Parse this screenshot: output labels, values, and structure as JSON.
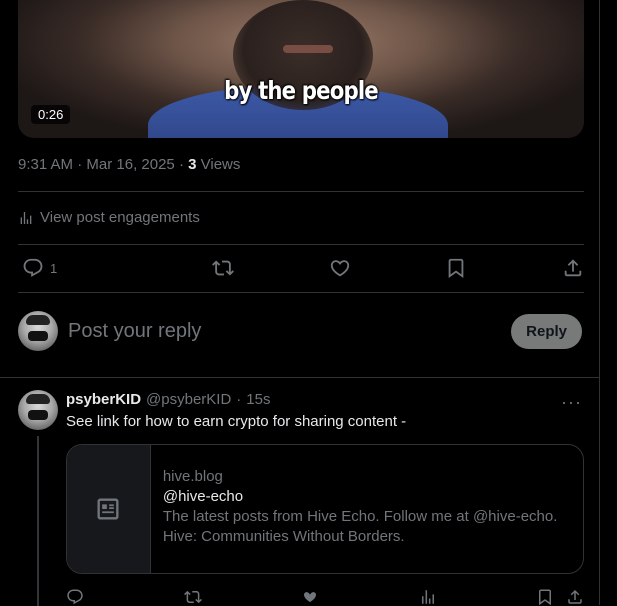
{
  "video": {
    "caption": "by the people",
    "duration": "0:26"
  },
  "post_meta": {
    "time": "9:31 AM",
    "sep1": " · ",
    "date": "Mar 16, 2025",
    "sep2": " · ",
    "views_count": "3",
    "views_label": " Views"
  },
  "engagements": {
    "label": "View post engagements",
    "icon": "analytics-icon"
  },
  "actions": {
    "reply_count": "1",
    "icons": [
      "reply-icon",
      "repost-icon",
      "like-icon",
      "bookmark-icon",
      "share-icon"
    ]
  },
  "reply_composer": {
    "placeholder": "Post your reply",
    "button": "Reply"
  },
  "reply_tweet": {
    "name": "psyberKID",
    "handle": "@psyberKID",
    "sep": "·",
    "time": "15s",
    "more": "···",
    "text": "See link for how to earn crypto for sharing content -",
    "card": {
      "domain": "hive.blog",
      "title": "@hive-echo",
      "description": "The latest posts from Hive Echo. Follow me at @hive-echo. Hive: Communities Without Borders."
    }
  },
  "colors": {
    "background": "#000000",
    "text": "#e7e9ea",
    "muted": "#71767b",
    "border": "#2f3336",
    "reply_button": "#787a7a"
  }
}
